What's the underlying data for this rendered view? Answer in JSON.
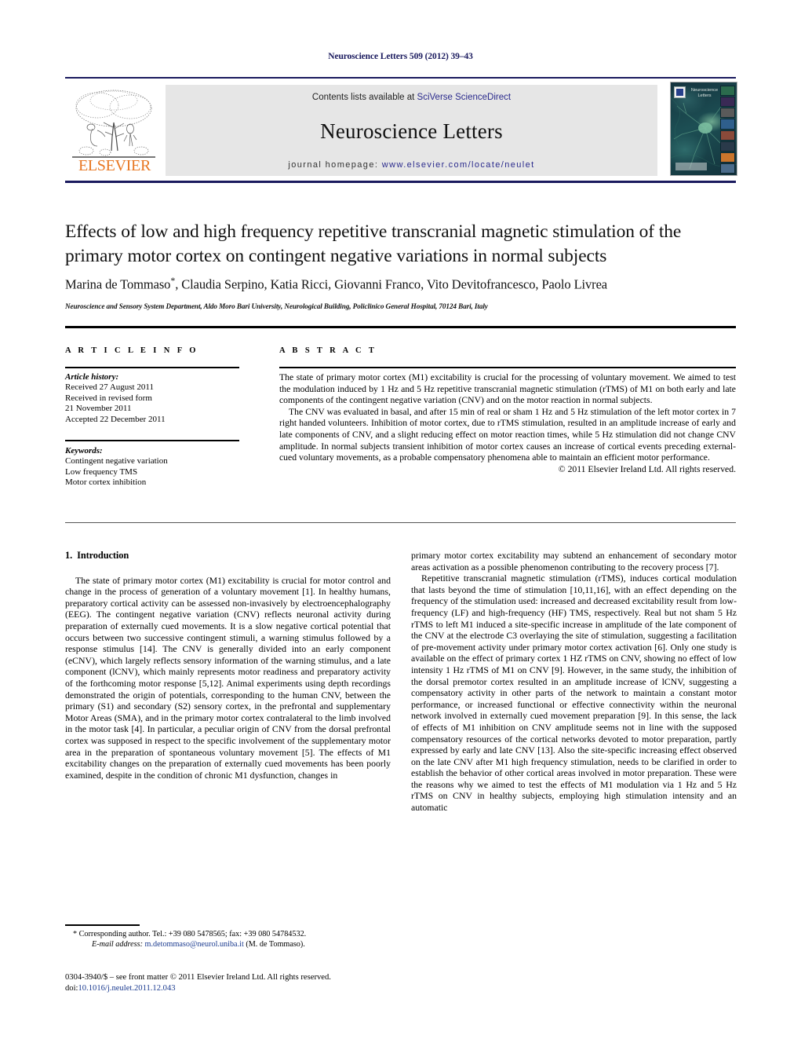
{
  "running_head": "Neuroscience Letters 509 (2012) 39–43",
  "journal_header": {
    "contents_prefix": "Contents lists available at ",
    "contents_link": "SciVerse ScienceDirect",
    "journal_title": "Neuroscience Letters",
    "homepage_prefix": "journal homepage: ",
    "homepage_url": "www.elsevier.com/locate/neulet",
    "publisher_name": "ELSEVIER",
    "cover_title": "Neuroscience Letters",
    "accent_orange": "#E87722",
    "link_blue": "#2a2a8c",
    "rule_navy": "#1a1a5e"
  },
  "article": {
    "title": "Effects of low and high frequency repetitive transcranial magnetic stimulation of the primary motor cortex on contingent negative variations in normal subjects",
    "authors": "Marina de Tommaso",
    "authors_rest": ", Claudia Serpino, Katia Ricci, Giovanni Franco, Vito Devitofrancesco, Paolo Livrea",
    "corresponding_marker": "*",
    "affiliation": "Neuroscience and Sensory System Department, Aldo Moro Bari University, Neurological Building, Policlinico General Hospital, 70124 Bari, Italy"
  },
  "article_info": {
    "label": "A R T I C L E   I N F O",
    "history_heading": "Article history:",
    "history_lines": [
      "Received 27 August 2011",
      "Received in revised form",
      "21 November 2011",
      "Accepted 22 December 2011"
    ],
    "keywords_heading": "Keywords:",
    "keywords": [
      "Contingent negative variation",
      "Low frequency TMS",
      "Motor cortex inhibition"
    ]
  },
  "abstract": {
    "label": "A B S T R A C T",
    "paragraph_1": "The state of primary motor cortex (M1) excitability is crucial for the processing of voluntary movement. We aimed to test the modulation induced by 1 Hz and 5 Hz repetitive transcranial magnetic stimulation (rTMS) of M1 on both early and late components of the contingent negative variation (CNV) and on the motor reaction in normal subjects.",
    "paragraph_2": "The CNV was evaluated in basal, and after 15 min of real or sham 1 Hz and 5 Hz stimulation of the left motor cortex in 7 right handed volunteers. Inhibition of motor cortex, due to rTMS stimulation, resulted in an amplitude increase of early and late components of CNV, and a slight reducing effect on motor reaction times, while 5 Hz stimulation did not change CNV amplitude. In normal subjects transient inhibition of motor cortex causes an increase of cortical events preceding external-cued voluntary movements, as a probable compensatory phenomena able to maintain an efficient motor performance.",
    "copyright": "© 2011 Elsevier Ireland Ltd. All rights reserved."
  },
  "body": {
    "section_1_number": "1.",
    "section_1_title": "Introduction",
    "left_col_paragraphs": [
      "The state of primary motor cortex (M1) excitability is crucial for motor control and change in the process of generation of a voluntary movement [1]. In healthy humans, preparatory cortical activity can be assessed non-invasively by electroencephalography (EEG). The contingent negative variation (CNV) reflects neuronal activity during preparation of externally cued movements. It is a slow negative cortical potential that occurs between two successive contingent stimuli, a warning stimulus followed by a response stimulus [14]. The CNV is generally divided into an early component (eCNV), which largely reflects sensory information of the warning stimulus, and a late component (lCNV), which mainly represents motor readiness and preparatory activity of the forthcoming motor response [5,12]. Animal experiments using depth recordings demonstrated the origin of potentials, corresponding to the human CNV, between the primary (S1) and secondary (S2) sensory cortex, in the prefrontal and supplementary Motor Areas (SMA), and in the primary motor cortex contralateral to the limb involved in the motor task [4]. In particular, a peculiar origin of CNV from the dorsal prefrontal cortex was supposed in respect to the specific involvement of the supplementary motor area in the preparation of spontaneous voluntary movement [5]. The effects of M1 excitability changes on the preparation of externally cued movements has been poorly examined, despite in the condition of chronic M1 dysfunction, changes in"
    ],
    "right_col_paragraphs": [
      "primary motor cortex excitability may subtend an enhancement of secondary motor areas activation as a possible phenomenon contributing to the recovery process [7].",
      "Repetitive transcranial magnetic stimulation (rTMS), induces cortical modulation that lasts beyond the time of stimulation [10,11,16], with an effect depending on the frequency of the stimulation used: increased and decreased excitability result from low-frequency (LF) and high-frequency (HF) TMS, respectively. Real but not sham 5 Hz rTMS to left M1 induced a site-specific increase in amplitude of the late component of the CNV at the electrode C3 overlaying the site of stimulation, suggesting a facilitation of pre-movement activity under primary motor cortex activation [6]. Only one study is available on the effect of primary cortex 1 HZ rTMS on CNV, showing no effect of low intensity 1 Hz rTMS of M1 on CNV [9]. However, in the same study, the inhibition of the dorsal premotor cortex resulted in an amplitude increase of lCNV, suggesting a compensatory activity in other parts of the network to maintain a constant motor performance, or increased functional or effective connectivity within the neuronal network involved in externally cued movement preparation [9]. In this sense, the lack of effects of M1 inhibition on CNV amplitude seems not in line with the supposed compensatory resources of the cortical networks devoted to motor preparation, partly expressed by early and late CNV [13]. Also the site-specific increasing effect observed on the late CNV after M1 high frequency stimulation, needs to be clarified in order to establish the behavior of other cortical areas involved in motor preparation. These were the reasons why we aimed to test the effects of M1 modulation via 1 Hz and 5 Hz rTMS on CNV in healthy subjects, employing high stimulation intensity and an automatic"
    ]
  },
  "footer": {
    "corresponding_marker": "*",
    "corresponding_text": "Corresponding author. Tel.: +39 080 5478565; fax: +39 080 54784532.",
    "email_label": "E-mail address:",
    "email_address": "m.detommaso@neurol.uniba.it",
    "email_owner": "(M. de Tommaso).",
    "issn_line": "0304-3940/$ – see front matter © 2011 Elsevier Ireland Ltd. All rights reserved.",
    "doi_label": "doi:",
    "doi_value": "10.1016/j.neulet.2011.12.043"
  }
}
